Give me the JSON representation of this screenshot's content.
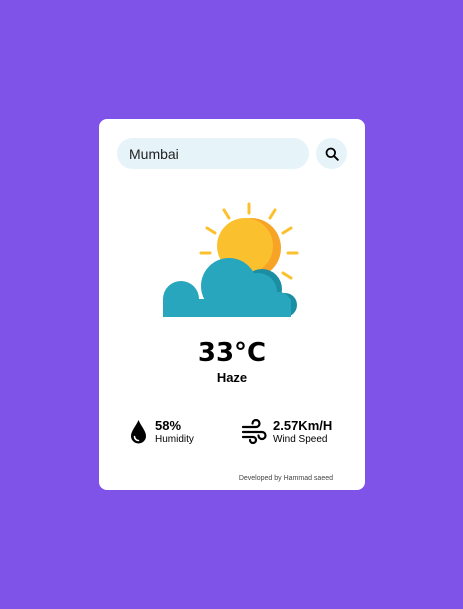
{
  "colors": {
    "background": "#7f52e8",
    "card": "#ffffff",
    "search_field": "#e6f4fa",
    "search_button": "#e6f4fa",
    "sun": "#fbc02d",
    "sun_shade": "#f7a325",
    "cloud": "#27a6bd",
    "cloud_shade": "#1c8ea4"
  },
  "search": {
    "value": "Mumbai",
    "button_icon": "search-icon"
  },
  "weather": {
    "icon": "sun-behind-cloud-icon",
    "temperature": "33°C",
    "condition": "Haze"
  },
  "details": {
    "humidity": {
      "icon": "water-drop-icon",
      "value": "58%",
      "label": "Humidity"
    },
    "wind": {
      "icon": "wind-icon",
      "value": "2.57Km/H",
      "label": "Wind Speed"
    }
  },
  "footer": {
    "text": "Developed by Hammad saeed"
  }
}
